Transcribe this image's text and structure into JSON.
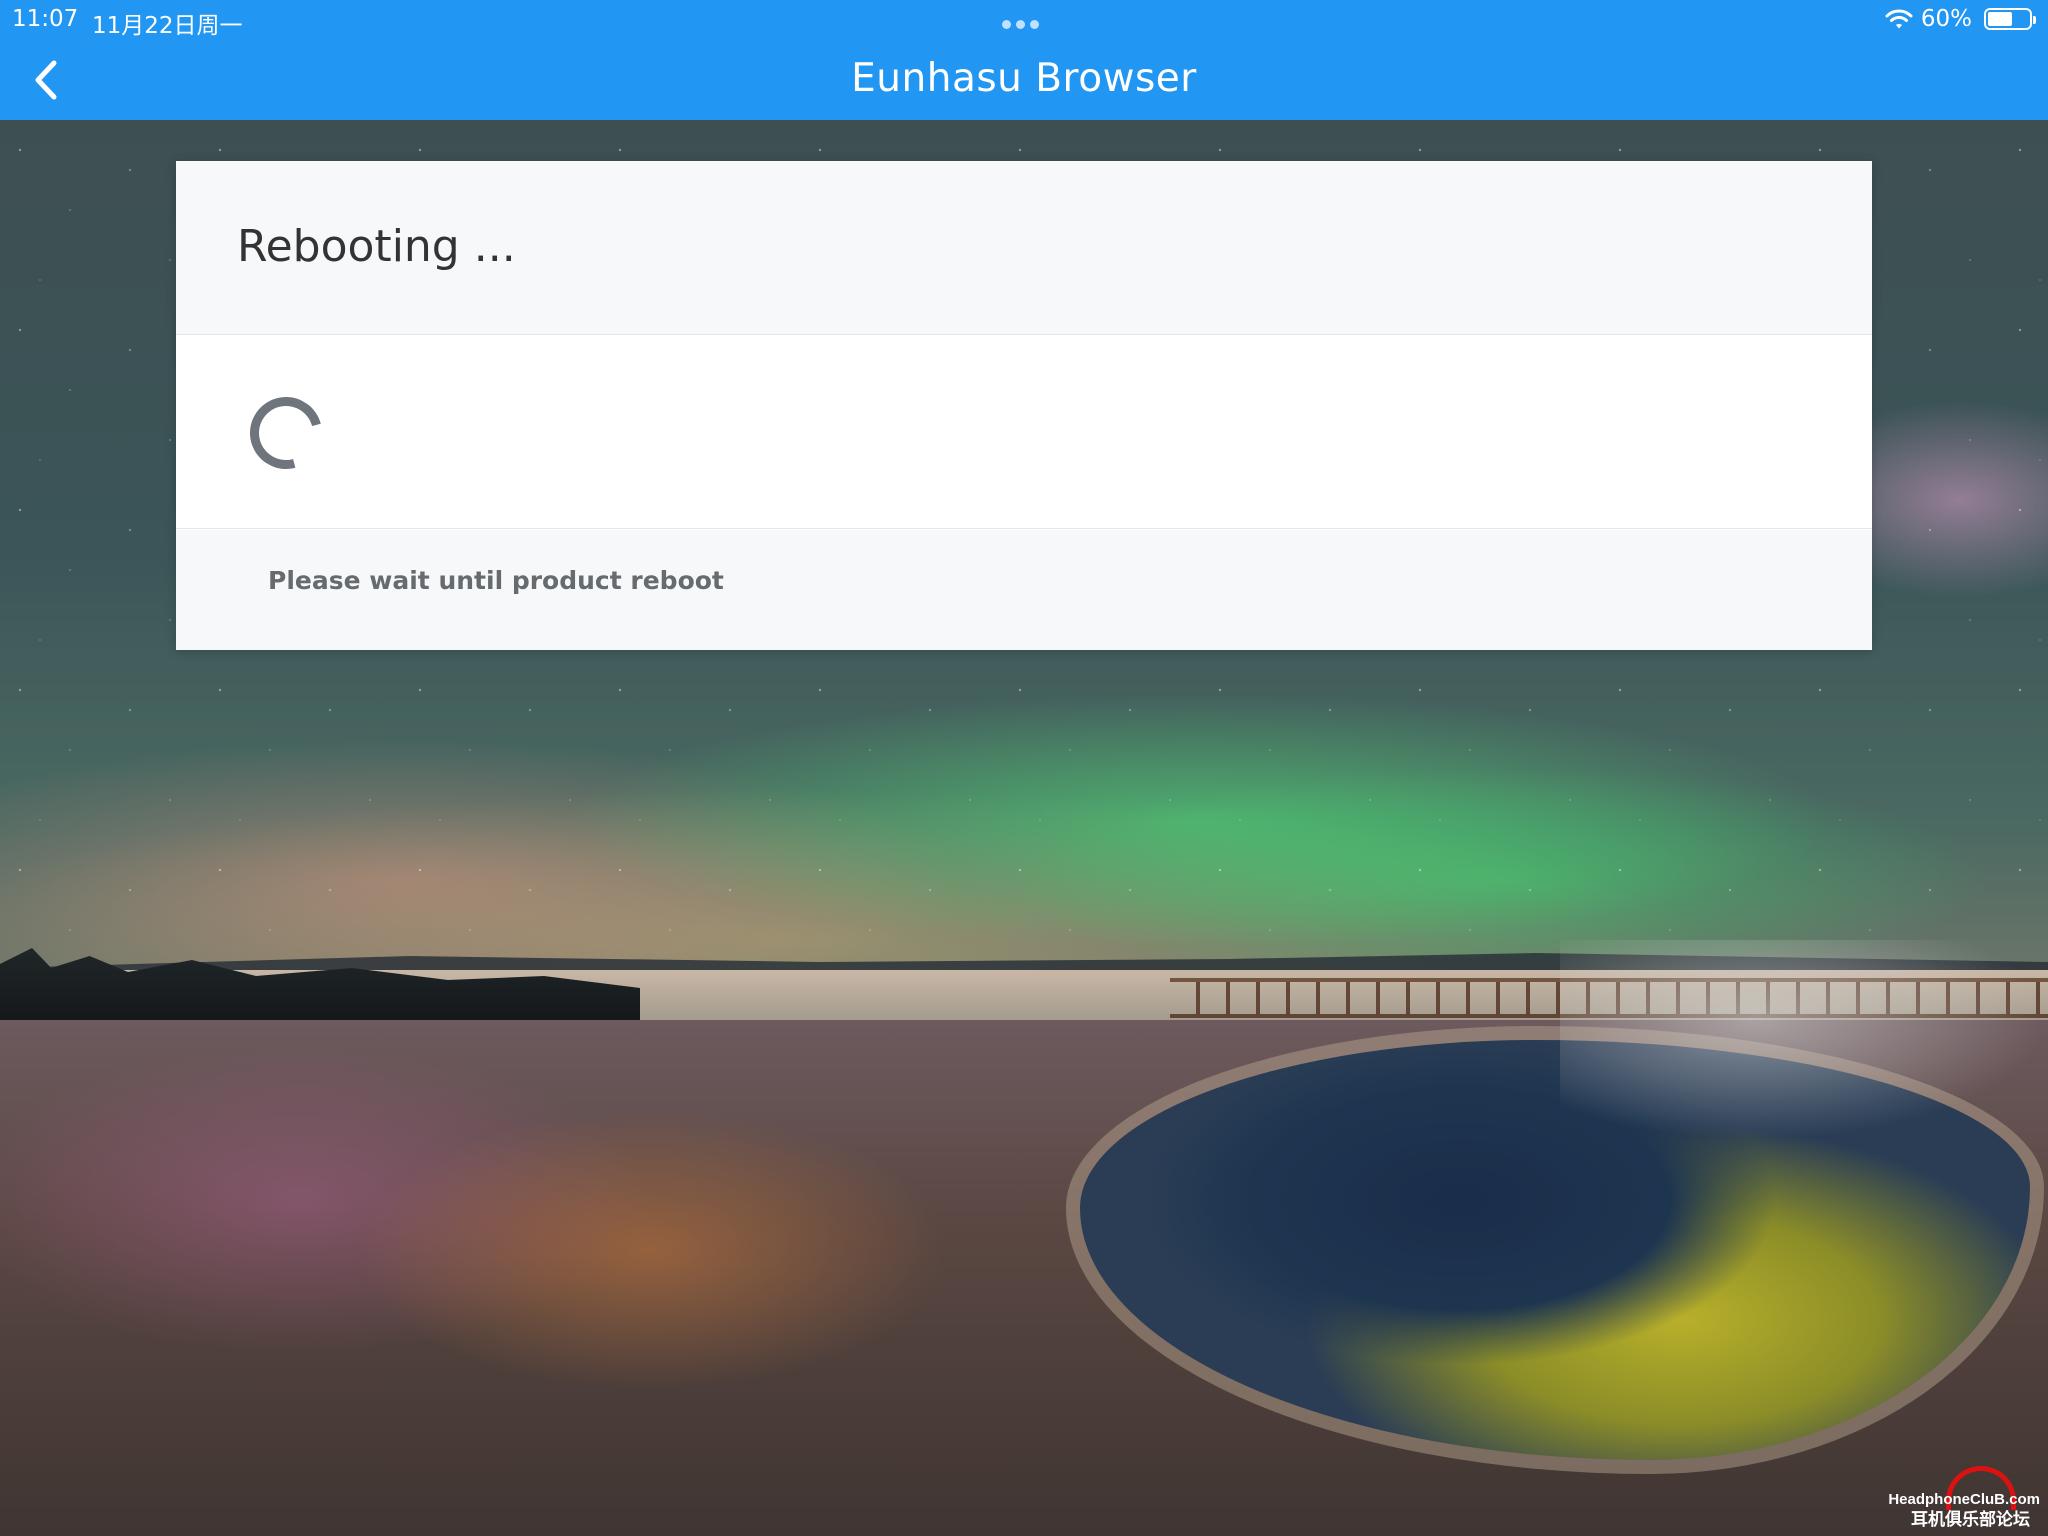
{
  "status_bar": {
    "time": "11:07",
    "date": "11月22日周一",
    "battery_percent_label": "60%",
    "battery_level": 0.6
  },
  "navbar": {
    "title": "Eunhasu Browser",
    "back_icon": "chevron-left-icon"
  },
  "modal": {
    "title": "Rebooting ...",
    "message": "Please wait until product reboot",
    "spinner_icon": "loading-spinner-icon"
  },
  "watermark": {
    "line1": "HeadphoneCluB.com",
    "line2": "耳机俱乐部论坛"
  },
  "colors": {
    "nav_bar": "#2196f3",
    "modal_header_bg": "#f7f8fa",
    "spinner": "#6e757c"
  }
}
